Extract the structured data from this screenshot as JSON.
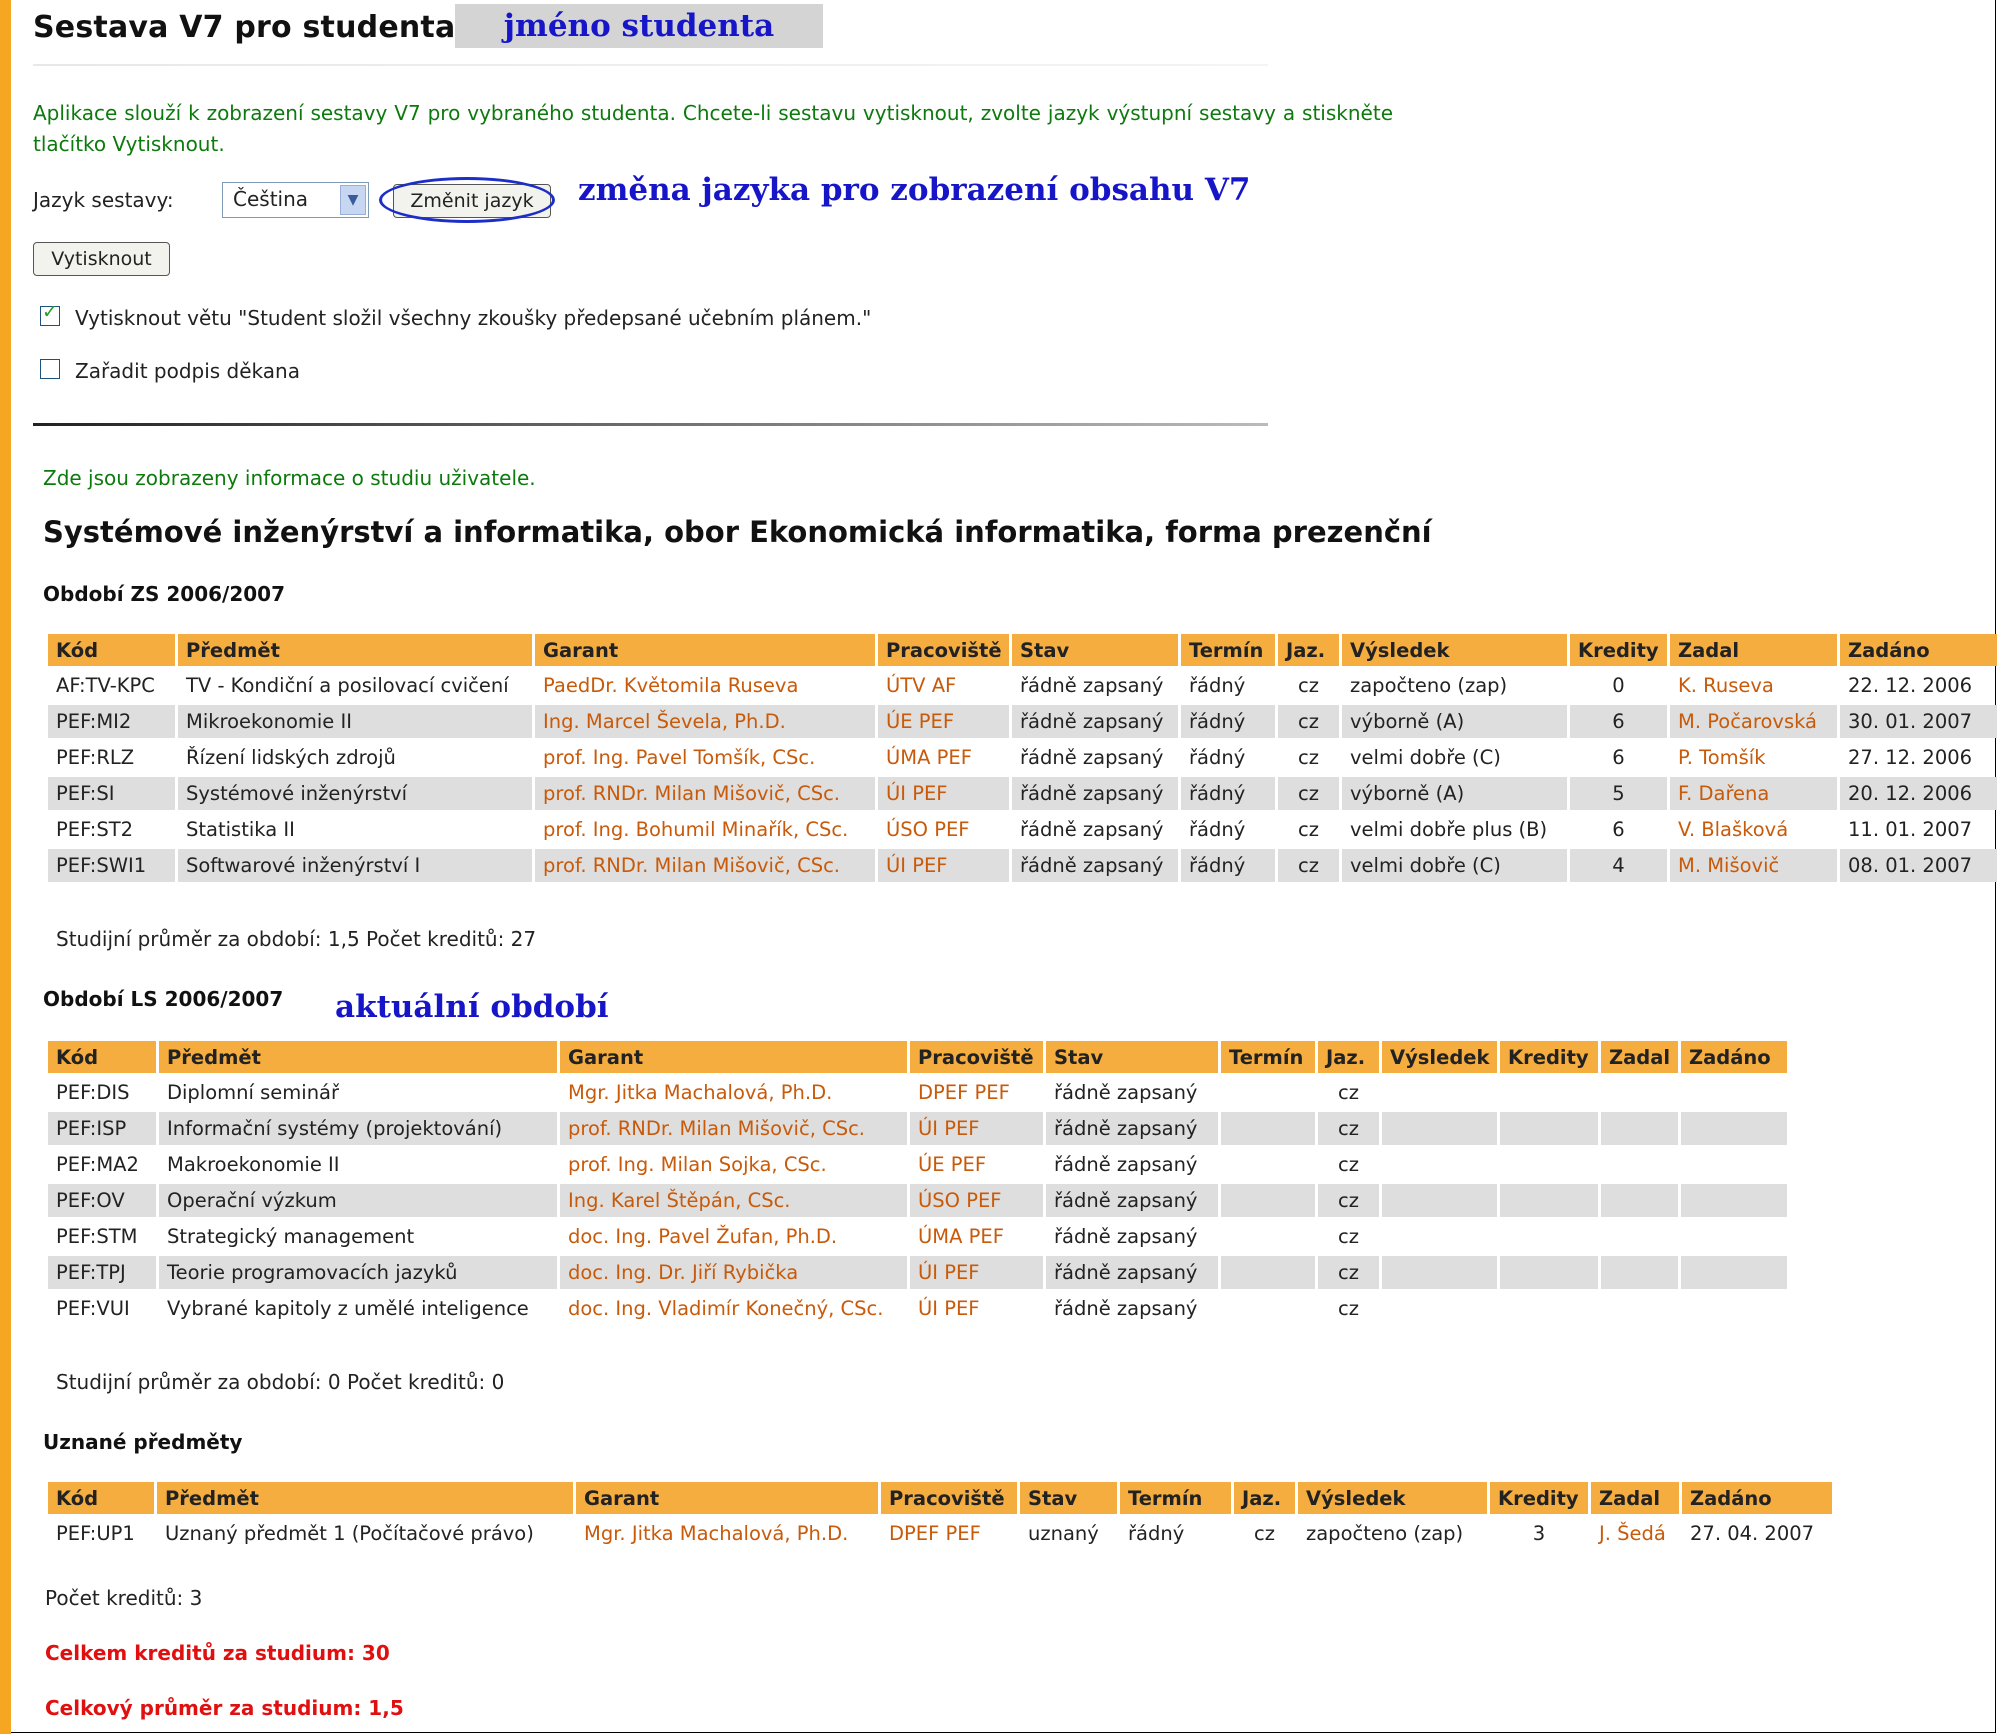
{
  "header": {
    "title": "Sestava V7 pro studenta",
    "student_name": "jméno studenta"
  },
  "intro": "Aplikace slouží k zobrazení sestavy V7 pro vybraného studenta. Chcete-li sestavu vytisknout, zvolte jazyk výstupní sestavy a stiskněte tlačítko Vytisknout.",
  "language": {
    "label": "Jazyk sestavy:",
    "selected": "Čeština",
    "change_button": "Změnit jazyk",
    "note": "změna jazyka pro zobrazení obsahu V7"
  },
  "print_button": "Vytisknout",
  "options": [
    {
      "label": "Vytisknout větu \"Student složil všechny zkoušky předepsané učebním plánem.\"",
      "checked": true
    },
    {
      "label": "Zařadit podpis děkana",
      "checked": false
    }
  ],
  "info_text": "Zde jsou zobrazeny informace o studiu uživatele.",
  "study_title": "Systémové inženýrství a informatika, obor Ekonomická informatika, forma prezenční",
  "period1": {
    "title": "Období ZS 2006/2007",
    "headers": [
      "Kód",
      "Předmět",
      "Garant",
      "Pracoviště",
      "Stav",
      "Termín",
      "Jaz.",
      "Výsledek",
      "Kredity",
      "Zadal",
      "Zadáno"
    ],
    "rows": [
      [
        "AF:TV-KPC",
        "TV - Kondiční a posilovací cvičení",
        "PaedDr. Květomila Ruseva",
        "ÚTV AF",
        "řádně zapsaný",
        "řádný",
        "cz",
        "započteno (zap)",
        "0",
        "K. Ruseva",
        "22. 12. 2006"
      ],
      [
        "PEF:MI2",
        "Mikroekonomie II",
        "Ing. Marcel Ševela, Ph.D.",
        "ÚE PEF",
        "řádně zapsaný",
        "řádný",
        "cz",
        "výborně (A)",
        "6",
        "M. Počarovská",
        "30. 01. 2007"
      ],
      [
        "PEF:RLZ",
        "Řízení lidských zdrojů",
        "prof. Ing. Pavel Tomšík, CSc.",
        "ÚMA PEF",
        "řádně zapsaný",
        "řádný",
        "cz",
        "velmi dobře (C)",
        "6",
        "P. Tomšík",
        "27. 12. 2006"
      ],
      [
        "PEF:SI",
        "Systémové inženýrství",
        "prof. RNDr. Milan Mišovič, CSc.",
        "ÚI PEF",
        "řádně zapsaný",
        "řádný",
        "cz",
        "výborně (A)",
        "5",
        "F. Dařena",
        "20. 12. 2006"
      ],
      [
        "PEF:ST2",
        "Statistika II",
        "prof. Ing. Bohumil Minařík, CSc.",
        "ÚSO PEF",
        "řádně zapsaný",
        "řádný",
        "cz",
        "velmi dobře plus (B)",
        "6",
        "V. Blašková",
        "11. 01. 2007"
      ],
      [
        "PEF:SWI1",
        "Softwarové inženýrství I",
        "prof. RNDr. Milan Mišovič, CSc.",
        "ÚI PEF",
        "řádně zapsaný",
        "řádný",
        "cz",
        "velmi dobře (C)",
        "4",
        "M. Mišovič",
        "08. 01. 2007"
      ]
    ],
    "summary": "Studijní průměr za období: 1,5    Počet kreditů: 27"
  },
  "period2": {
    "title": "Období LS 2006/2007",
    "note": "aktuální období",
    "headers": [
      "Kód",
      "Předmět",
      "Garant",
      "Pracoviště",
      "Stav",
      "Termín",
      "Jaz.",
      "Výsledek",
      "Kredity",
      "Zadal",
      "Zadáno"
    ],
    "rows": [
      [
        "PEF:DIS",
        "Diplomní seminář",
        "Mgr. Jitka Machalová, Ph.D.",
        "DPEF PEF",
        "řádně zapsaný",
        "",
        "cz",
        "",
        "",
        "",
        ""
      ],
      [
        "PEF:ISP",
        "Informační systémy (projektování)",
        "prof. RNDr. Milan Mišovič, CSc.",
        "ÚI PEF",
        "řádně zapsaný",
        "",
        "cz",
        "",
        "",
        "",
        ""
      ],
      [
        "PEF:MA2",
        "Makroekonomie II",
        "prof. Ing. Milan Sojka, CSc.",
        "ÚE PEF",
        "řádně zapsaný",
        "",
        "cz",
        "",
        "",
        "",
        ""
      ],
      [
        "PEF:OV",
        "Operační výzkum",
        "Ing. Karel Štěpán, CSc.",
        "ÚSO PEF",
        "řádně zapsaný",
        "",
        "cz",
        "",
        "",
        "",
        ""
      ],
      [
        "PEF:STM",
        "Strategický management",
        "doc. Ing. Pavel Žufan, Ph.D.",
        "ÚMA PEF",
        "řádně zapsaný",
        "",
        "cz",
        "",
        "",
        "",
        ""
      ],
      [
        "PEF:TPJ",
        "Teorie programovacích jazyků",
        "doc. Ing. Dr. Jiří Rybička",
        "ÚI PEF",
        "řádně zapsaný",
        "",
        "cz",
        "",
        "",
        "",
        ""
      ],
      [
        "PEF:VUI",
        "Vybrané kapitoly z umělé inteligence",
        "doc. Ing. Vladimír Konečný, CSc.",
        "ÚI PEF",
        "řádně zapsaný",
        "",
        "cz",
        "",
        "",
        "",
        ""
      ]
    ],
    "summary": "Studijní průměr za období: 0    Počet kreditů: 0"
  },
  "recognized": {
    "title": "Uznané předměty",
    "headers": [
      "Kód",
      "Předmět",
      "Garant",
      "Pracoviště",
      "Stav",
      "Termín",
      "Jaz.",
      "Výsledek",
      "Kredity",
      "Zadal",
      "Zadáno"
    ],
    "rows": [
      [
        "PEF:UP1",
        "Uznaný předmět 1 (Počítačové právo)",
        "Mgr. Jitka Machalová, Ph.D.",
        "DPEF PEF",
        "uznaný",
        "řádný",
        "cz",
        "započteno (zap)",
        "3",
        "J. Šedá",
        "27. 04. 2007"
      ]
    ],
    "summary": "Počet kreditů: 3"
  },
  "totals": {
    "credits": "Celkem kreditů za studium: 30",
    "average": "Celkový průměr za studium: 1,5"
  },
  "colors": {
    "accent": "#f6ad40",
    "link": "#c85a0a",
    "annotation": "#1616c8",
    "intro_text": "#0d7a0d",
    "totals": "#e01010"
  }
}
